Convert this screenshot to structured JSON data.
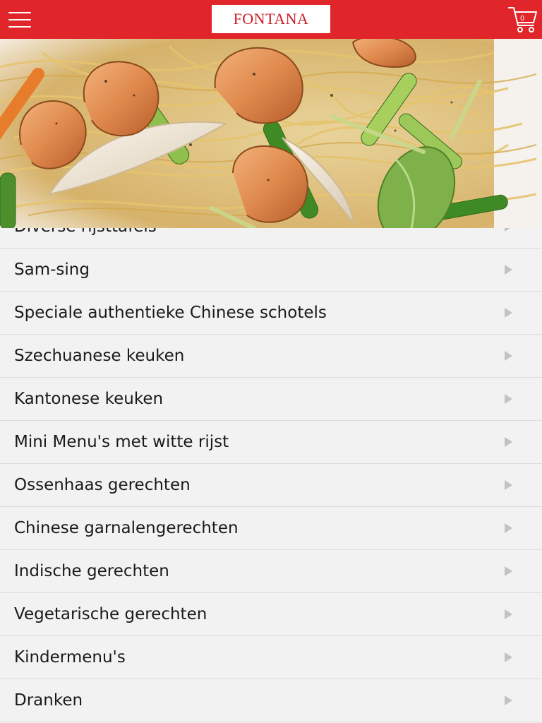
{
  "header": {
    "logo_text": "FONTANA",
    "cart_count": "0",
    "icons": {
      "menu": "hamburger-icon",
      "cart": "cart-icon"
    }
  },
  "hero": {
    "image_subject": "stir-fried noodles with shrimp, spring onion and snow peas"
  },
  "colors": {
    "header_bg": "#e0262a",
    "logo_text": "#c9202a",
    "list_bg": "#f2f2f2",
    "divider": "#dcdcdc",
    "chevron": "#c2c2c2"
  },
  "categories": [
    {
      "label": "Diverse rijsttafels"
    },
    {
      "label": "Sam-sing"
    },
    {
      "label": "Speciale authentieke Chinese schotels"
    },
    {
      "label": "Szechuanese keuken"
    },
    {
      "label": "Kantonese keuken"
    },
    {
      "label": "Mini Menu's met witte rijst"
    },
    {
      "label": "Ossenhaas gerechten"
    },
    {
      "label": "Chinese garnalengerechten"
    },
    {
      "label": "Indische gerechten"
    },
    {
      "label": "Vegetarische gerechten"
    },
    {
      "label": "Kindermenu's"
    },
    {
      "label": "Dranken"
    }
  ]
}
